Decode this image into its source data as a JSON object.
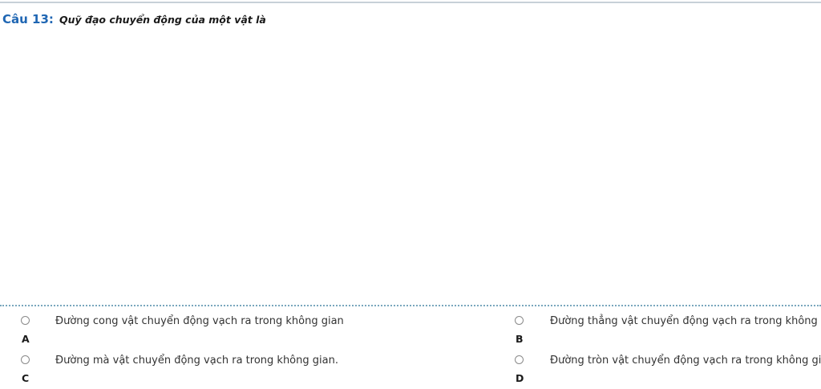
{
  "question": {
    "number_label": "Câu 13:",
    "text": "Quỹ đạo chuyển động của một vật là"
  },
  "answers": [
    {
      "letter": "A",
      "text": "Đường cong vật chuyển động vạch ra trong không gian",
      "selected": false
    },
    {
      "letter": "B",
      "text": "Đường thẳng vật chuyển động vạch ra trong không gian",
      "selected": false
    },
    {
      "letter": "C",
      "text": "Đường mà vật chuyển động vạch ra trong không gian.",
      "selected": false
    },
    {
      "letter": "D",
      "text": "Đường tròn vật chuyển động vạch ra trong không gian.",
      "selected": false
    }
  ],
  "colors": {
    "question_number": "#1f66b3",
    "divider": "#79a7bd"
  }
}
